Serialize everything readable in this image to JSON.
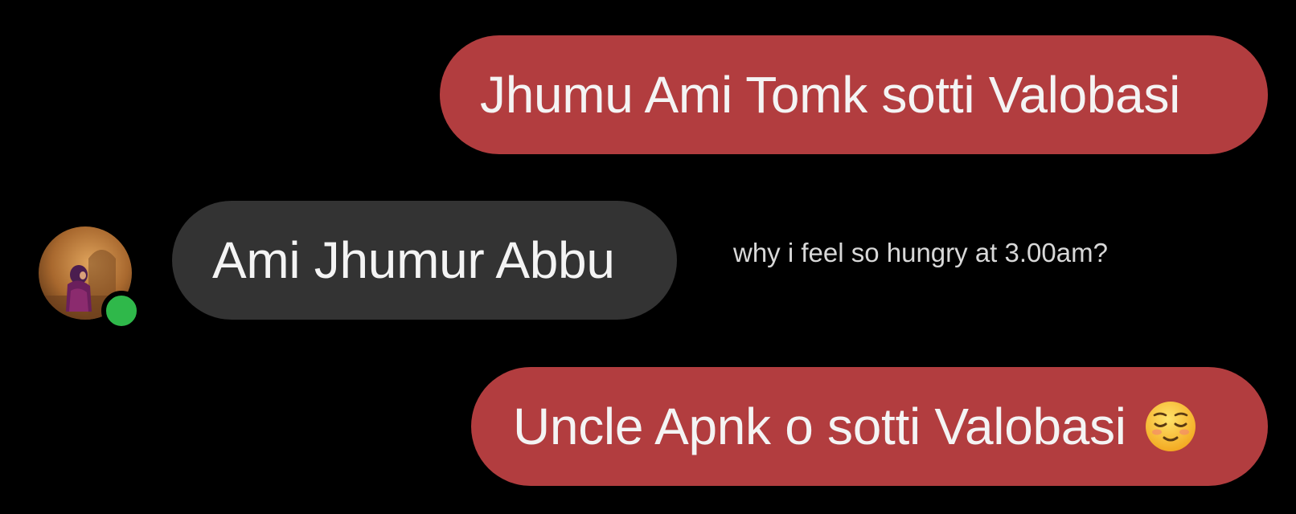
{
  "conversation": {
    "messages": [
      {
        "direction": "outgoing",
        "text": "Jhumu Ami Tomk sotti Valobasi"
      },
      {
        "direction": "incoming",
        "text": "Ami Jhumur Abbu"
      },
      {
        "direction": "outgoing",
        "text": "Uncle Apnk o sotti Valobasi",
        "emoji": "relieved-face"
      }
    ],
    "contact": {
      "online": true
    }
  },
  "caption": "why i feel so hungry at 3.00am?",
  "colors": {
    "background": "#000000",
    "outgoing_bubble": "#b23d3f",
    "incoming_bubble": "#333333",
    "online_indicator": "#2fb84a",
    "text": "#f4f4f4"
  }
}
